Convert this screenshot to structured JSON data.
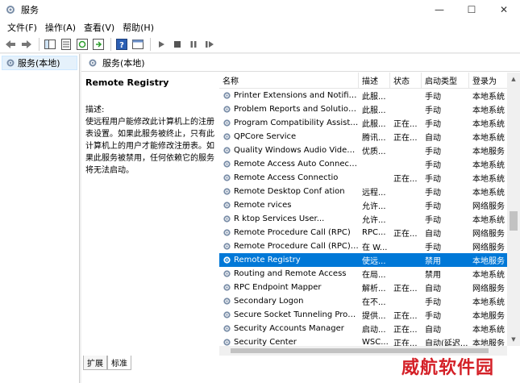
{
  "window": {
    "title": "服务"
  },
  "window_controls": {
    "minimize": "—",
    "maximize": "☐",
    "close": "✕"
  },
  "menu": [
    "文件(F)",
    "操作(A)",
    "查看(V)",
    "帮助(H)"
  ],
  "toolbar": {
    "icons": [
      "back-icon",
      "forward-icon",
      "show-hide-tree-icon",
      "properties-icon",
      "refresh-icon",
      "export-icon",
      "help-icon",
      "console-icon",
      "start-icon",
      "stop-icon",
      "pause-icon",
      "restart-icon"
    ]
  },
  "tree": {
    "root": "服务(本地)"
  },
  "panel": {
    "title": "服务(本地)"
  },
  "description": {
    "service_name": "Remote Registry",
    "label": "描述:",
    "text": "使远程用户能修改此计算机上的注册表设置。如果此服务被终止，只有此计算机上的用户才能修改注册表。如果此服务被禁用，任何依赖它的服务将无法启动。"
  },
  "columns": {
    "name": "名称",
    "desc": "描述",
    "status": "状态",
    "start": "启动类型",
    "logon": "登录为"
  },
  "rows": [
    {
      "name": "Printer Extensions and Notificat...",
      "desc": "此服...",
      "status": "",
      "start": "手动",
      "logon": "本地系统"
    },
    {
      "name": "Problem Reports and Solutions...",
      "desc": "此服...",
      "status": "",
      "start": "手动",
      "logon": "本地系统"
    },
    {
      "name": "Program Compatibility Assistan...",
      "desc": "此服...",
      "status": "正在...",
      "start": "手动",
      "logon": "本地系统"
    },
    {
      "name": "QPCore Service",
      "desc": "腾讯...",
      "status": "正在...",
      "start": "自动",
      "logon": "本地系统"
    },
    {
      "name": "Quality Windows Audio Video E...",
      "desc": "优质...",
      "status": "",
      "start": "手动",
      "logon": "本地服务"
    },
    {
      "name": "Remote Access Auto Connectio...",
      "desc": "",
      "status": "",
      "start": "手动",
      "logon": "本地系统"
    },
    {
      "name": "Remote Access Connectio",
      "desc": "",
      "status": "正在...",
      "start": "手动",
      "logon": "本地系统"
    },
    {
      "name": "Remote Desktop Conf   ation",
      "desc": "远程...",
      "status": "",
      "start": "手动",
      "logon": "本地系统"
    },
    {
      "name": "Remote     rvices",
      "desc": "允许...",
      "status": "",
      "start": "手动",
      "logon": "网络服务"
    },
    {
      "name": "R     ktop Services User...",
      "desc": "允许...",
      "status": "",
      "start": "手动",
      "logon": "本地系统"
    },
    {
      "name": "Remote Procedure Call (RPC)",
      "desc": "RPC...",
      "status": "正在...",
      "start": "自动",
      "logon": "网络服务"
    },
    {
      "name": "Remote Procedure Call (RPC) L...",
      "desc": "在 W...",
      "status": "",
      "start": "手动",
      "logon": "网络服务"
    },
    {
      "name": "Remote Registry",
      "desc": "使远...",
      "status": "",
      "start": "禁用",
      "logon": "本地服务"
    },
    {
      "name": "Routing and Remote Access",
      "desc": "在局...",
      "status": "",
      "start": "禁用",
      "logon": "本地系统"
    },
    {
      "name": "RPC Endpoint Mapper",
      "desc": "解析...",
      "status": "正在...",
      "start": "自动",
      "logon": "网络服务"
    },
    {
      "name": "Secondary Logon",
      "desc": "在不...",
      "status": "",
      "start": "手动",
      "logon": "本地系统"
    },
    {
      "name": "Secure Socket Tunneling Protoc...",
      "desc": "提供...",
      "status": "正在...",
      "start": "手动",
      "logon": "本地服务"
    },
    {
      "name": "Security Accounts Manager",
      "desc": "启动...",
      "status": "正在...",
      "start": "自动",
      "logon": "本地系统"
    },
    {
      "name": "Security Center",
      "desc": "WSC...",
      "status": "正在...",
      "start": "自动(延迟...",
      "logon": "本地服务"
    }
  ],
  "selected_row_index": 12,
  "tabs": [
    "扩展",
    "标准"
  ],
  "watermark": "威航软件园",
  "colors": {
    "selection": "#0078d7",
    "gear": "#7a8ea8",
    "watermark": "#d42027"
  }
}
